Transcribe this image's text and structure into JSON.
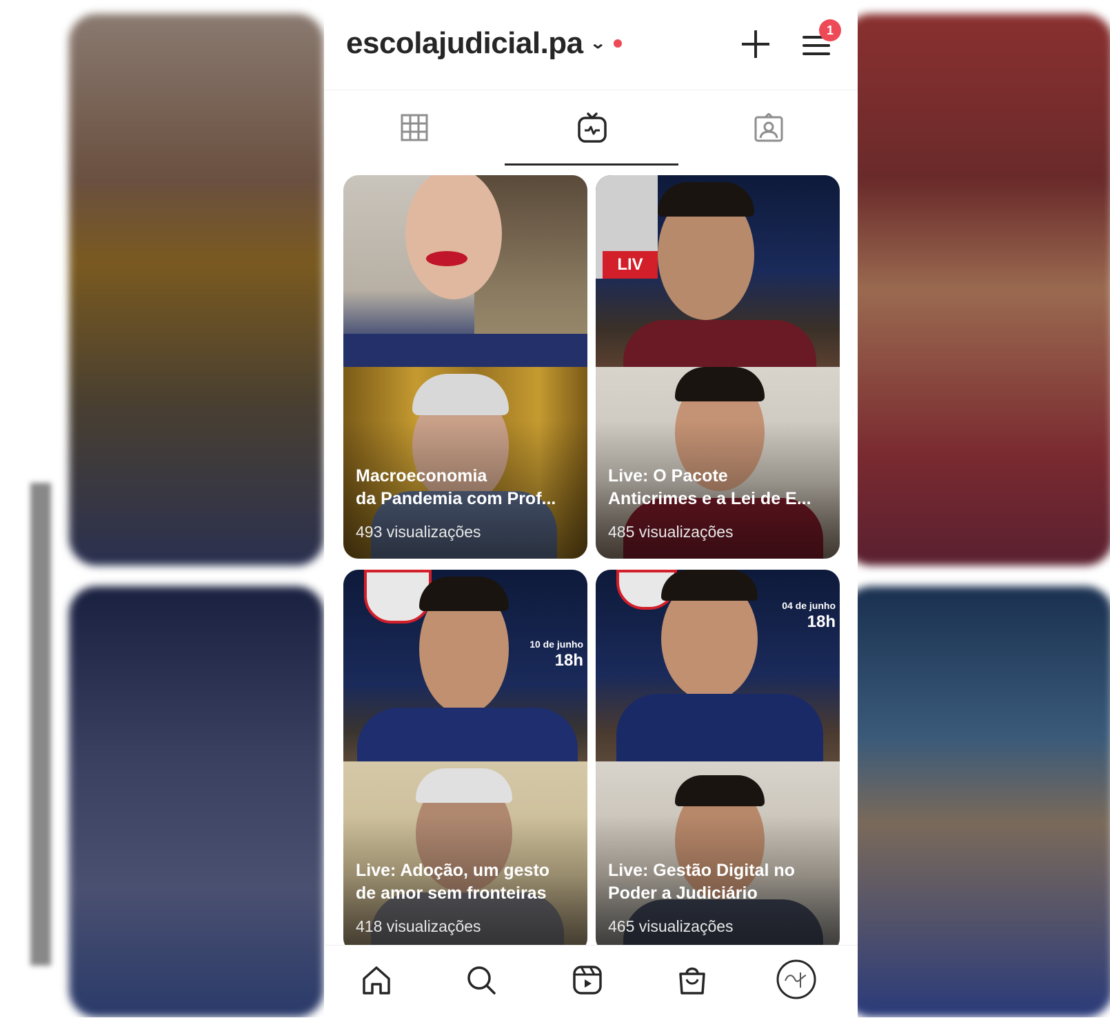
{
  "header": {
    "account_name": "escolajudicial.pa",
    "notification_count": "1"
  },
  "tabs": [
    {
      "icon": "grid-icon",
      "active": false
    },
    {
      "icon": "igtv-icon",
      "active": true
    },
    {
      "icon": "tagged-icon",
      "active": false
    }
  ],
  "videos": [
    {
      "title_line1": "Macroeconomia",
      "title_line2": "da Pandemia com Prof...",
      "views": "493 visualizações"
    },
    {
      "title_line1": "Live: O Pacote",
      "title_line2": "Anticrimes e a Lei de E...",
      "views": "485 visualizações"
    },
    {
      "title_line1": "Live: Adoção, um gesto",
      "title_line2": "de amor sem fronteiras",
      "views": "418 visualizações"
    },
    {
      "title_line1": "Live: Gestão Digital no",
      "title_line2": "Poder a Judiciário",
      "views": "465 visualizações"
    }
  ],
  "thumb_text": {
    "live": "LIV",
    "date1": "10 de junho",
    "time1": "18h",
    "date2": "04 de junho",
    "time2": "18h"
  },
  "bottom_nav": [
    "home-icon",
    "search-icon",
    "reels-icon",
    "shop-icon",
    "profile-avatar"
  ],
  "colors": {
    "accent_red": "#ed4956",
    "text_dark": "#262626"
  }
}
